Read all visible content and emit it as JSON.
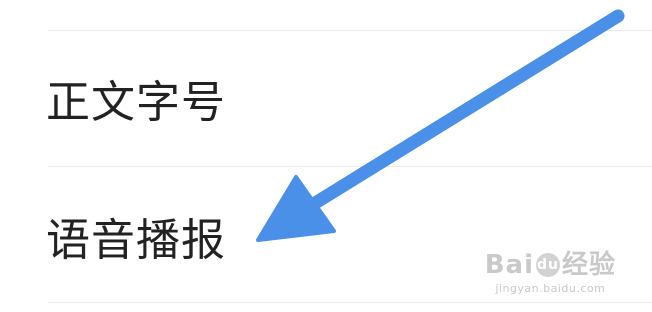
{
  "settings": {
    "items": [
      {
        "label": "正文字号"
      },
      {
        "label": "语音播报"
      }
    ]
  },
  "annotation": {
    "arrow_color": "#4A8FE8",
    "arrow_points_to": "语音播报"
  },
  "watermark": {
    "brand_left": "Bai",
    "brand_right": "经验",
    "url": "jingyan.baidu.com"
  }
}
